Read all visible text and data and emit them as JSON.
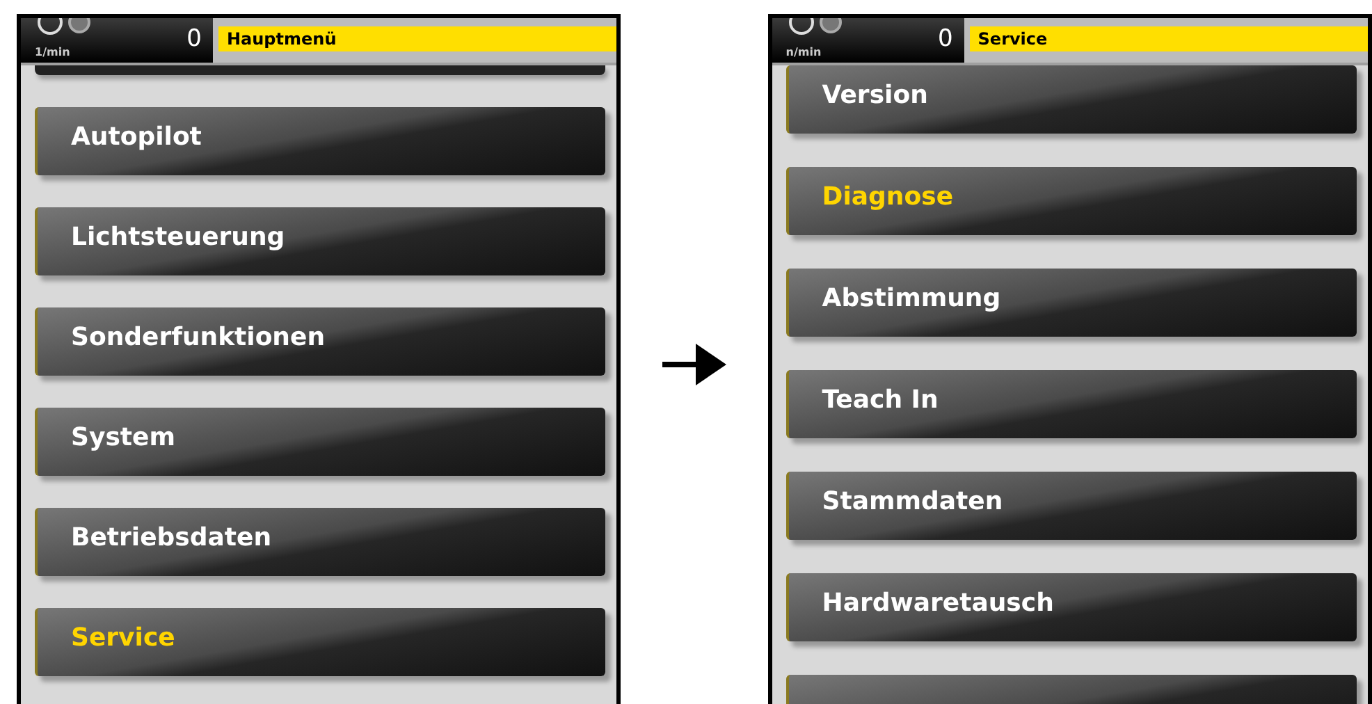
{
  "screens": [
    {
      "header": {
        "unit": "1/min",
        "value": "0",
        "title": "Hauptmenü"
      },
      "partial_top": true,
      "partial_bottom": false,
      "items": [
        {
          "label": "Autopilot",
          "selected": false
        },
        {
          "label": "Lichtsteuerung",
          "selected": false
        },
        {
          "label": "Sonderfunktionen",
          "selected": false
        },
        {
          "label": "System",
          "selected": false
        },
        {
          "label": "Betriebsdaten",
          "selected": false
        },
        {
          "label": "Service",
          "selected": true
        }
      ]
    },
    {
      "header": {
        "unit": "n/min",
        "value": "0",
        "title": "Service"
      },
      "partial_top": false,
      "partial_bottom": true,
      "items": [
        {
          "label": "Version",
          "selected": false
        },
        {
          "label": "Diagnose",
          "selected": true
        },
        {
          "label": "Abstimmung",
          "selected": false
        },
        {
          "label": "Teach In",
          "selected": false
        },
        {
          "label": "Stammdaten",
          "selected": false
        },
        {
          "label": "Hardwaretausch",
          "selected": false
        }
      ]
    }
  ]
}
